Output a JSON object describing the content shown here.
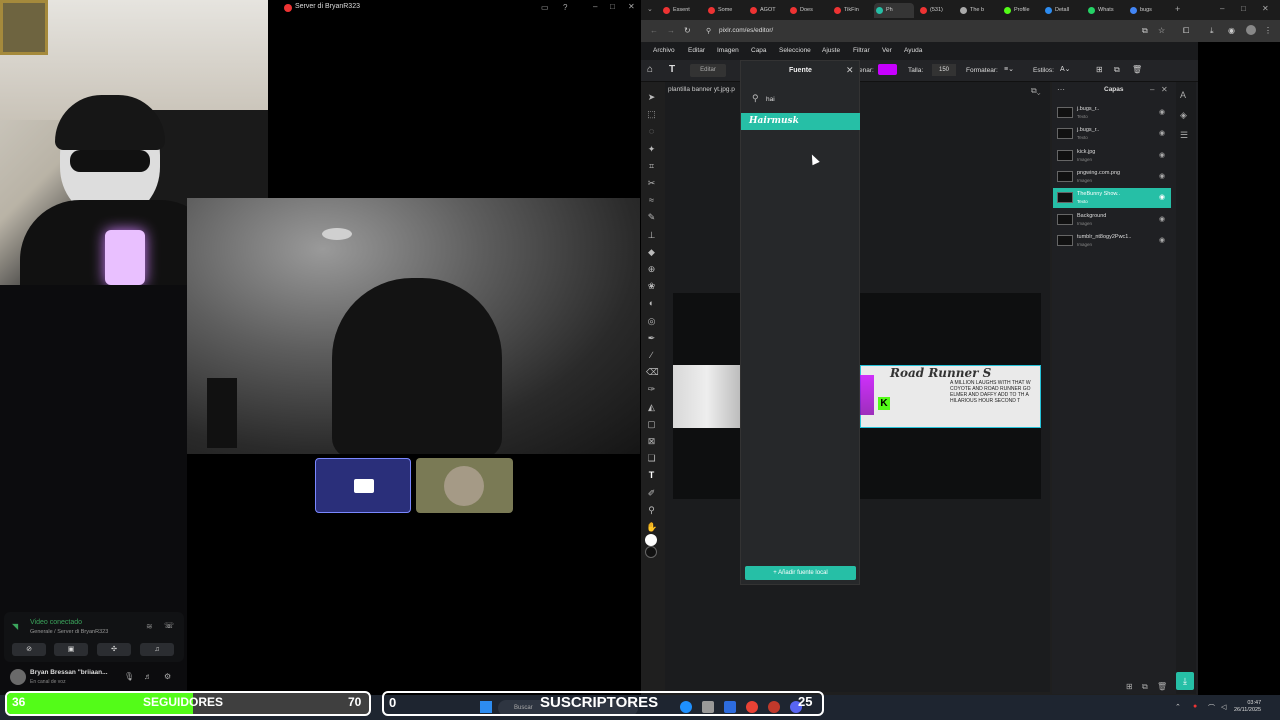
{
  "discord": {
    "window_title": "Server di BryanR323",
    "voice_status": "Video conectado",
    "voice_channel": "Generale / Server di BryanR323",
    "user_name": "Bryan Bressan \"briiaan...",
    "user_status": "En canal de voz"
  },
  "browser": {
    "tabs": [
      {
        "label": "Essent",
        "color": "#e33"
      },
      {
        "label": "Some",
        "color": "#e33"
      },
      {
        "label": "AGOT",
        "color": "#e33"
      },
      {
        "label": "Does",
        "color": "#e33"
      },
      {
        "label": "TikFin",
        "color": "#e33"
      },
      {
        "label": "Ph",
        "color": "#26bfa6"
      },
      {
        "label": "(531)",
        "color": "#e33"
      },
      {
        "label": "The b",
        "color": "#aaa"
      },
      {
        "label": "Profile",
        "color": "#53fc18"
      },
      {
        "label": "Detall",
        "color": "#2d8cf0"
      },
      {
        "label": "Whats",
        "color": "#25d366"
      },
      {
        "label": "bugs",
        "color": "#4285f4"
      }
    ],
    "url": "pixlr.com/es/editor/"
  },
  "pixlr": {
    "menu": [
      "Archivo",
      "Editar",
      "Imagen",
      "Capa",
      "Seleccione",
      "Ajuste",
      "Filtrar",
      "Ver",
      "Ayuda"
    ],
    "toolbar": {
      "edit_label": "Editar",
      "fill_label": "enar:",
      "size_label": "Talla:",
      "size_value": "150",
      "format_label": "Formatear:",
      "styles_label": "Estilos:",
      "accent": "#26bfa6",
      "fill_color": "#c800ff"
    },
    "document_tab": "plantilla banner yt.jpg.p",
    "font_panel": {
      "title": "Fuente",
      "search_value": "hai",
      "result": "Hairmusk",
      "add_button": "Añadir fuente local"
    },
    "banner": {
      "title": "Road Runner S",
      "subtitle": "A MILLION LAUGHS WITH THAT W COYOTE AND ROAD RUNNER GO ELMER AND DAFFY ADD TO TH A HILARIOUS HOUR SECOND T",
      "kick_logo": "K"
    },
    "layers_panel": {
      "title": "Capas",
      "layers": [
        {
          "name": "j.bugs_r..",
          "type": "Texto"
        },
        {
          "name": "j.bugs_r..",
          "type": "Texto"
        },
        {
          "name": "kick.jpg",
          "type": "Imagen"
        },
        {
          "name": "pngwing.com.png",
          "type": "Imagen"
        },
        {
          "name": "TheBunny Show..",
          "type": "Texto",
          "selected": true
        },
        {
          "name": "Background",
          "type": "Imagen"
        },
        {
          "name": "tumblr_nt8ogy2Pwc1..",
          "type": "Imagen"
        }
      ]
    }
  },
  "taskbar": {
    "search_placeholder": "Buscar",
    "time": "03:47",
    "date": "26/11/2025"
  },
  "overlay": {
    "followers": {
      "count": "36",
      "label": "SEGUIDORES",
      "goal": "70",
      "progress": 0.514
    },
    "subscribers": {
      "count": "0",
      "label": "SUSCRIPTORES",
      "goal": "25",
      "progress": 0
    }
  }
}
